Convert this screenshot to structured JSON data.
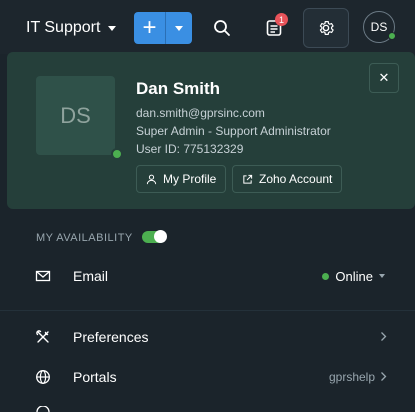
{
  "topbar": {
    "department": "IT Support",
    "add_label": "+",
    "notification_count": "1",
    "avatar_initials": "DS"
  },
  "profile": {
    "initials": "DS",
    "name": "Dan Smith",
    "email": "dan.smith@gprsinc.com",
    "role": "Super Admin - Support Administrator",
    "user_id": "User ID: 775132329",
    "close_label": "✕",
    "my_profile_label": "My Profile",
    "zoho_account_label": "Zoho Account",
    "status": "online"
  },
  "menu": {
    "availability_label": "MY AVAILABILITY",
    "availability_on": true,
    "email": {
      "label": "Email",
      "status": "Online"
    },
    "preferences": {
      "label": "Preferences"
    },
    "portals": {
      "label": "Portals",
      "value": "gprshelp"
    }
  },
  "colors": {
    "accent": "#3a8fe3",
    "online": "#4caf50",
    "badge": "#e8535a",
    "card_bg": "#253f3a",
    "page_bg": "#1b242b"
  }
}
